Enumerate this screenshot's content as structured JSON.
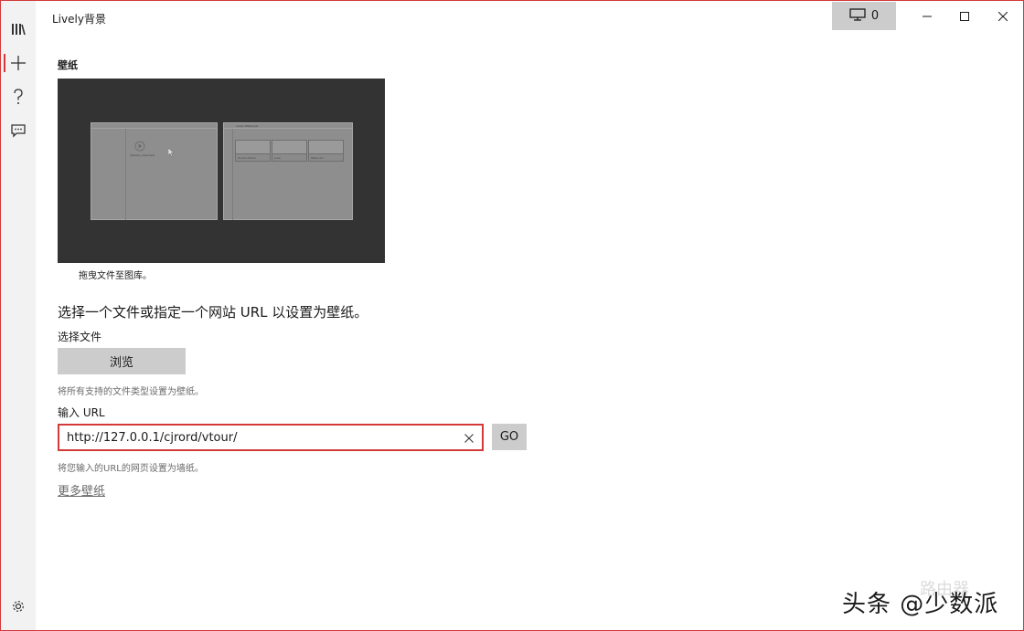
{
  "app": {
    "title": "Lively背景"
  },
  "titlebar": {
    "monitor_count": "0"
  },
  "nav": {
    "items": [
      {
        "name": "library",
        "icon": "library-icon"
      },
      {
        "name": "add",
        "icon": "plus-icon",
        "active": true
      },
      {
        "name": "help",
        "icon": "question-icon"
      },
      {
        "name": "feedback",
        "icon": "chat-icon"
      }
    ],
    "settings_icon": "gear-icon"
  },
  "wallpaper": {
    "section_title": "壁纸",
    "preview_caption": "拖曳文件至图库。",
    "preview_left_label": "sample_videomp4",
    "preview_right_title": "Lively Wallpaper",
    "preview_tiles": [
      "Sound Action",
      "Lock",
      "Wave Art"
    ]
  },
  "main": {
    "heading": "选择一个文件或指定一个网站 URL 以设置为壁纸。",
    "choose_file_label": "选择文件",
    "browse_label": "浏览",
    "browse_hint": "将所有支持的文件类型设置为壁纸。",
    "url_label": "输入 URL",
    "url_value": "http://127.0.0.1/cjrord/vtour/",
    "go_label": "GO",
    "url_hint": "将您输入的URL的网页设置为墙纸。",
    "more_link": "更多壁纸"
  },
  "watermark": {
    "text": "头条 @少数派",
    "faint_text": "路由器"
  },
  "colors": {
    "accent": "#d23a3a",
    "rail_bg": "#f2f2f2",
    "button_bg": "#cccccc",
    "preview_bg": "#333333"
  }
}
